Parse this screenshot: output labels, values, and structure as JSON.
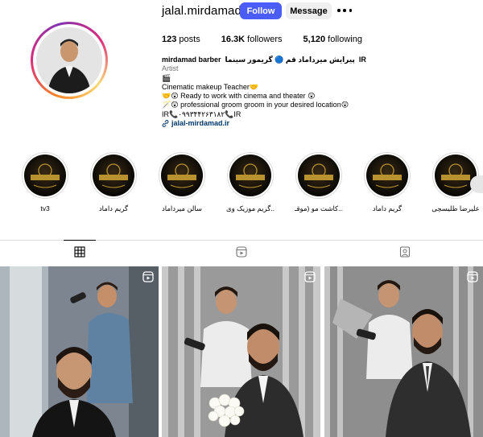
{
  "profile": {
    "username": "jalal.mirdamad",
    "follow_label": "Follow",
    "message_label": "Message",
    "more_icon": "more-options-icon",
    "stats": {
      "posts_count": "123",
      "posts_label": "posts",
      "followers_count": "16.3K",
      "followers_label": "followers",
      "following_count": "5,120",
      "following_label": "following"
    },
    "bio": {
      "name_left": "mirdamad barber",
      "name_right": "پیرایش میرداماد قم 🔵 گریمور سینما",
      "name_badge": "IR",
      "category": "Artist",
      "line_emoji": "🎬",
      "line1": "Cinematic makeup Teacher🤝",
      "line2": "🤝😲 Ready to work with cinema and theater 😲",
      "line3": "🪄😲 professional groom groom in your desired location😲",
      "line4": "IR📞۰۹۹۳۴۴۲۶۳۱۸۲📞IR",
      "link": "jalal-mirdamad.ir"
    }
  },
  "highlights": [
    {
      "label": "tv3"
    },
    {
      "label": "گریم داماد"
    },
    {
      "label": "سالن میرداماد"
    },
    {
      "label": "گریم موزیک وی..."
    },
    {
      "label": "کاشت مو (موقـ..."
    },
    {
      "label": "گریم داماد"
    },
    {
      "label": "علیرضا طلیسچی"
    }
  ],
  "tabs": [
    {
      "icon": "grid-icon"
    },
    {
      "icon": "reels-icon"
    },
    {
      "icon": "tagged-icon"
    }
  ],
  "posts": [
    {
      "type": "reel"
    },
    {
      "type": "reel"
    },
    {
      "type": "reel"
    }
  ],
  "colors": {
    "follow_button": "#4a5df9",
    "message_button": "#efefef",
    "link": "#00376b",
    "muted": "#737373"
  }
}
